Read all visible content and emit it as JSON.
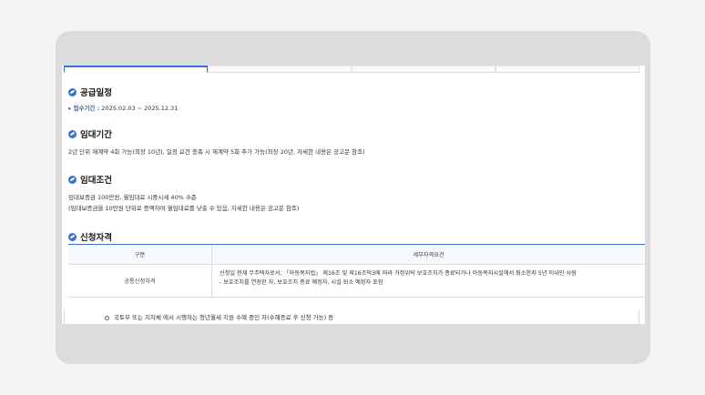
{
  "tabs": [
    "",
    "",
    "",
    ""
  ],
  "sections": {
    "supply_schedule": {
      "title": "공급일정",
      "period_label": "▸ 접수기간 :",
      "period_value": " 2025.02.03 ~ 2025.12.31"
    },
    "lease_period": {
      "title": "임대기간",
      "text": "2년 단위 재계약 4회 가능(최장 10년), 일정 요건 충족 시 재계약 5회 추가 가능(최장 20년, 자세한 내용은 공고문 참조)"
    },
    "lease_terms": {
      "title": "임대조건",
      "line1": "임대보증금 100만원, 월임대료 시중시세 40% 수준",
      "line2": "(임대보증금을 10만원 단위로 증액하여 월임대료를 낮출 수 있음, 자세한 내용은 공고문 참조)"
    },
    "eligibility": {
      "title": "신청자격",
      "table": {
        "headers": [
          "구분",
          "세부자격요건"
        ],
        "rows": [
          {
            "category": "공통신청자격",
            "detail_line1": "신청일 현재 무주택자로서, 「아동복지법」 제16조 및 제16조의3에 따라 가정위탁 보호조치가 종료되거나 아동복지시설에서 퇴소한지 5년 이내인 사람",
            "detail_line2": "- 보호조치를 연장한 자, 보호조치 종료 예정자, 시설 퇴소 예정자 포함"
          }
        ]
      },
      "extra_item": "국토부 또는 지자체 에서 시행하는 청년월세 지원 수혜 중인 자(수혜종료 후 신청 가능) 등"
    }
  },
  "colors": {
    "accent": "#3d6fd1",
    "device": "#dcdcde",
    "background": "#f4f4f5"
  }
}
